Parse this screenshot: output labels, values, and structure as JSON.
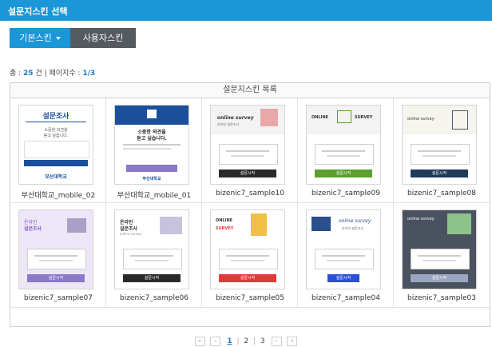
{
  "header": {
    "title": "설문지스킨 선택"
  },
  "tabs": [
    {
      "label": "기본스킨",
      "active": true
    },
    {
      "label": "사용자스킨",
      "active": false
    }
  ],
  "summary": {
    "total_prefix": "총 : ",
    "total": "25",
    "total_suffix": " 건 | 페이지수 : ",
    "pages": "1/3"
  },
  "panel": {
    "title": "설문지스킨 목록"
  },
  "skins": [
    {
      "name": "부산대학교_mobile_02"
    },
    {
      "name": "부산대학교_mobile_01"
    },
    {
      "name": "bizenic7_sample10"
    },
    {
      "name": "bizenic7_sample09"
    },
    {
      "name": "bizenic7_sample08"
    },
    {
      "name": "bizenic7_sample07"
    },
    {
      "name": "bizenic7_sample06"
    },
    {
      "name": "bizenic7_sample05"
    },
    {
      "name": "bizenic7_sample04"
    },
    {
      "name": "bizenic7_sample03"
    }
  ],
  "thumb_text": {
    "m02_title": "설문조사",
    "m02_line1": "소중한 의견을",
    "m02_line2": "듣고 싶습니다.",
    "m02_logo": "부산대학교",
    "m01_line1": "소중한 의견을",
    "m01_line2": "듣고 싶습니다.",
    "m01_logo": "부산대학교",
    "online_survey": "online survey",
    "korean_survey": "온라인 설문조사",
    "online_caps": "ONLINE",
    "survey_caps": "SURVEY",
    "s07_title1": "온라인",
    "s07_title2": "설문조사",
    "s06_title1": "온라인",
    "s06_title2": "설문조사",
    "start_btn": "설문시작"
  },
  "pagination": {
    "first": "«",
    "prev": "‹",
    "next": "›",
    "last": "»",
    "pages": [
      "1",
      "2",
      "3"
    ],
    "current": "1",
    "sep": "|"
  },
  "colors": {
    "accent": "#1b96d6",
    "tab_inactive": "#555a60",
    "pnu_blue": "#1b4f9c",
    "green": "#5aa02c",
    "red": "#e03a3a",
    "purple": "#8a78c9"
  }
}
